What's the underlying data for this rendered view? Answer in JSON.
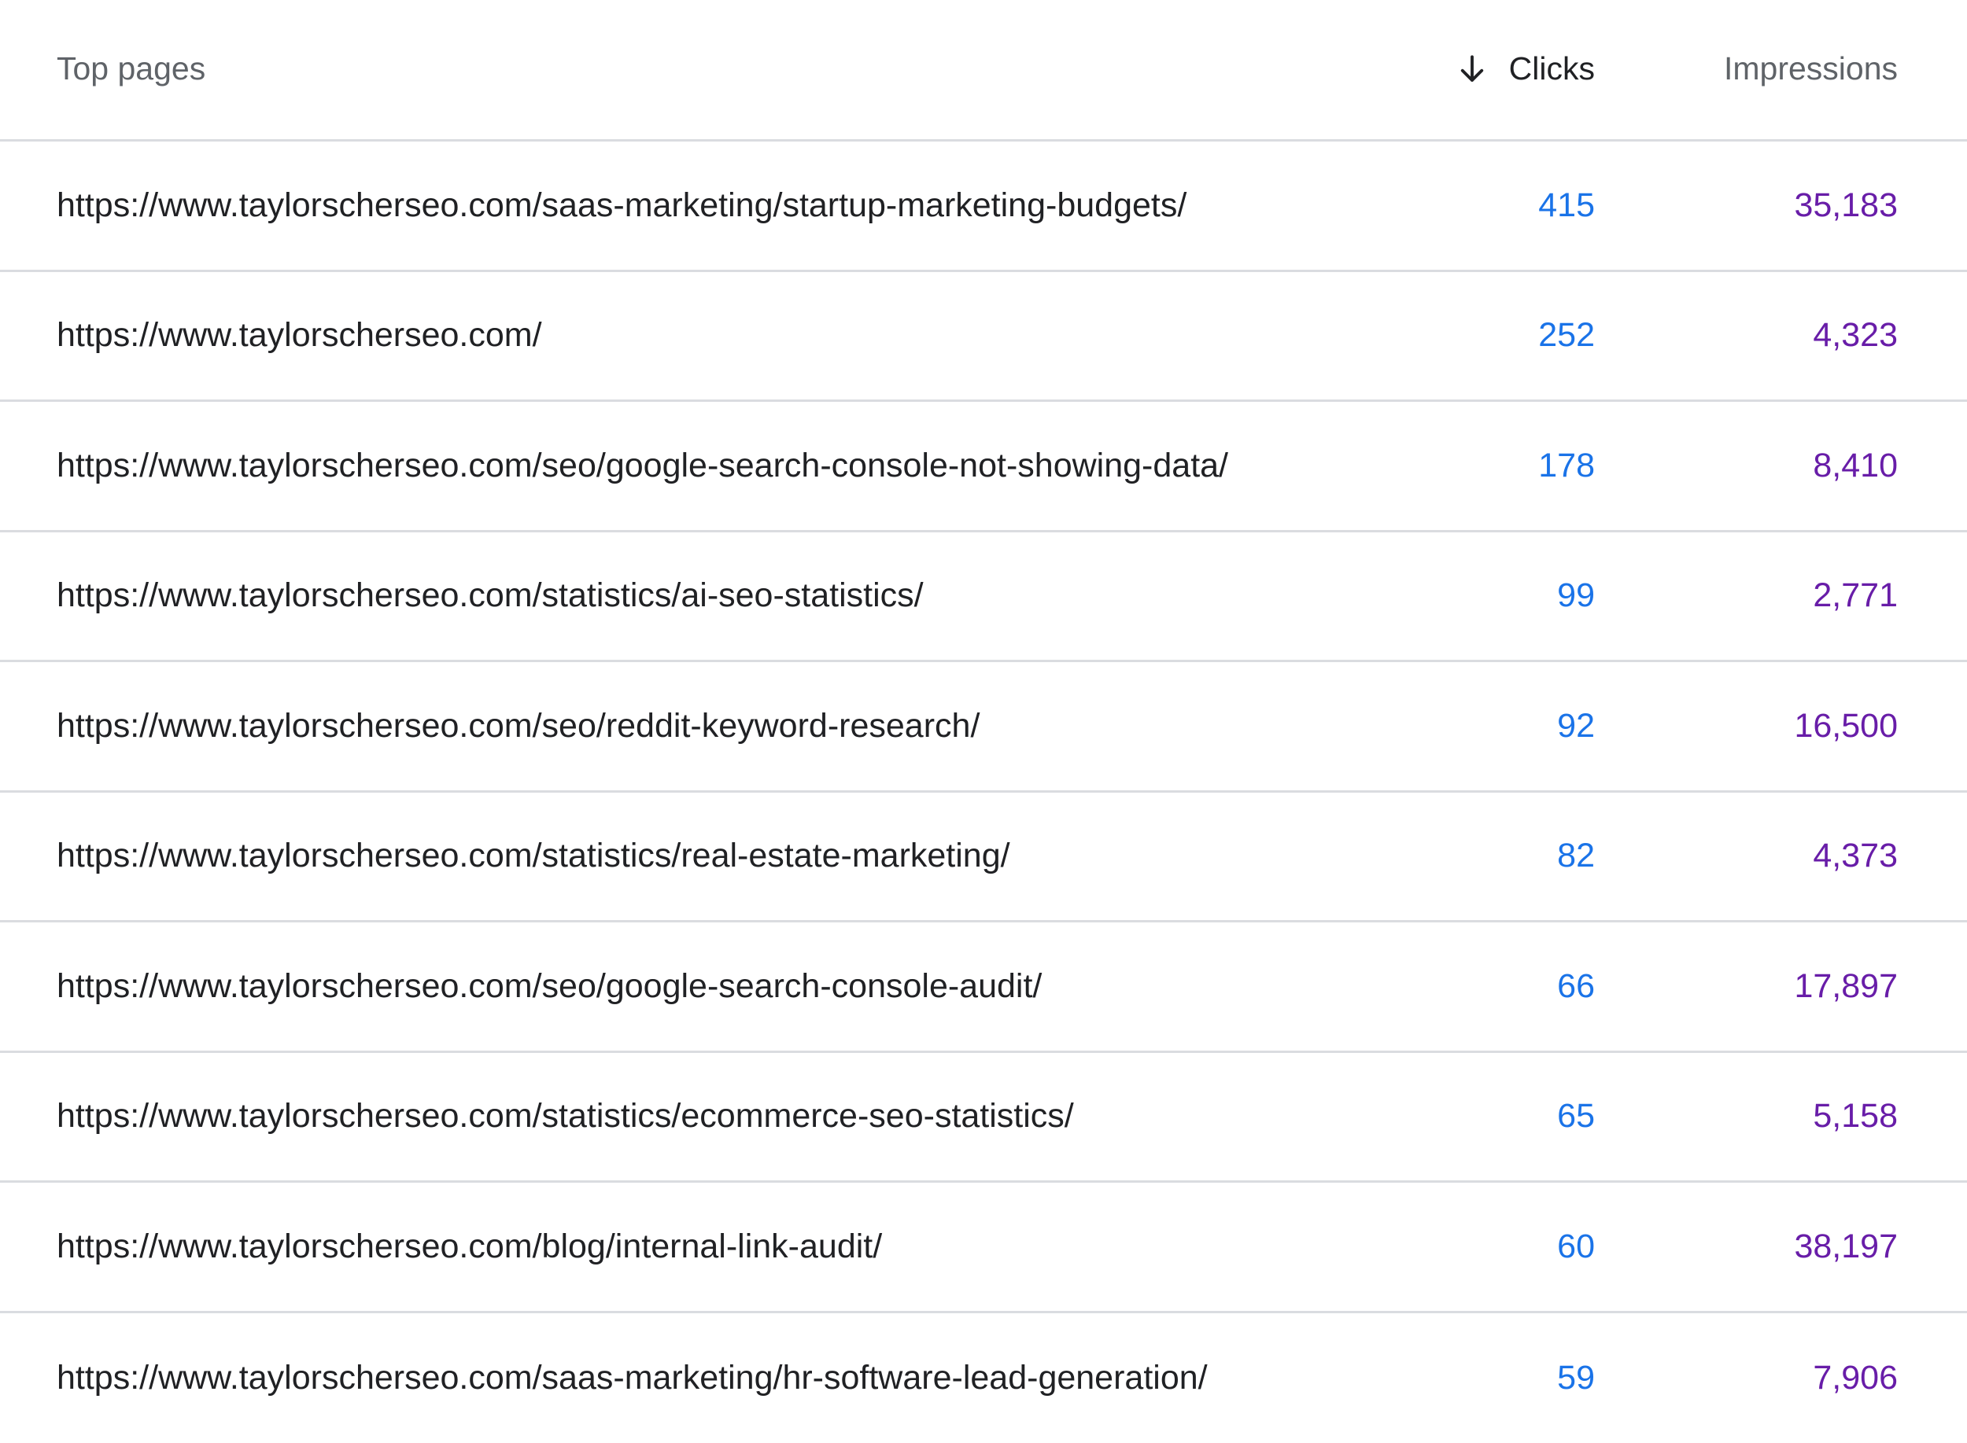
{
  "header": {
    "pages_label": "Top pages",
    "clicks_label": "Clicks",
    "impressions_label": "Impressions",
    "sort_icon": "arrow-down-icon"
  },
  "colors": {
    "clicks": "#1a73e8",
    "impressions": "#681da8",
    "divider": "#dadce0",
    "header_text": "#5f6368"
  },
  "rows": [
    {
      "url": "https://www.taylorscherseo.com/saas-marketing/startup-marketing-budgets/",
      "clicks": "415",
      "impressions": "35,183"
    },
    {
      "url": "https://www.taylorscherseo.com/",
      "clicks": "252",
      "impressions": "4,323"
    },
    {
      "url": "https://www.taylorscherseo.com/seo/google-search-console-not-showing-data/",
      "clicks": "178",
      "impressions": "8,410"
    },
    {
      "url": "https://www.taylorscherseo.com/statistics/ai-seo-statistics/",
      "clicks": "99",
      "impressions": "2,771"
    },
    {
      "url": "https://www.taylorscherseo.com/seo/reddit-keyword-research/",
      "clicks": "92",
      "impressions": "16,500"
    },
    {
      "url": "https://www.taylorscherseo.com/statistics/real-estate-marketing/",
      "clicks": "82",
      "impressions": "4,373"
    },
    {
      "url": "https://www.taylorscherseo.com/seo/google-search-console-audit/",
      "clicks": "66",
      "impressions": "17,897"
    },
    {
      "url": "https://www.taylorscherseo.com/statistics/ecommerce-seo-statistics/",
      "clicks": "65",
      "impressions": "5,158"
    },
    {
      "url": "https://www.taylorscherseo.com/blog/internal-link-audit/",
      "clicks": "60",
      "impressions": "38,197"
    },
    {
      "url": "https://www.taylorscherseo.com/saas-marketing/hr-software-lead-generation/",
      "clicks": "59",
      "impressions": "7,906"
    }
  ]
}
